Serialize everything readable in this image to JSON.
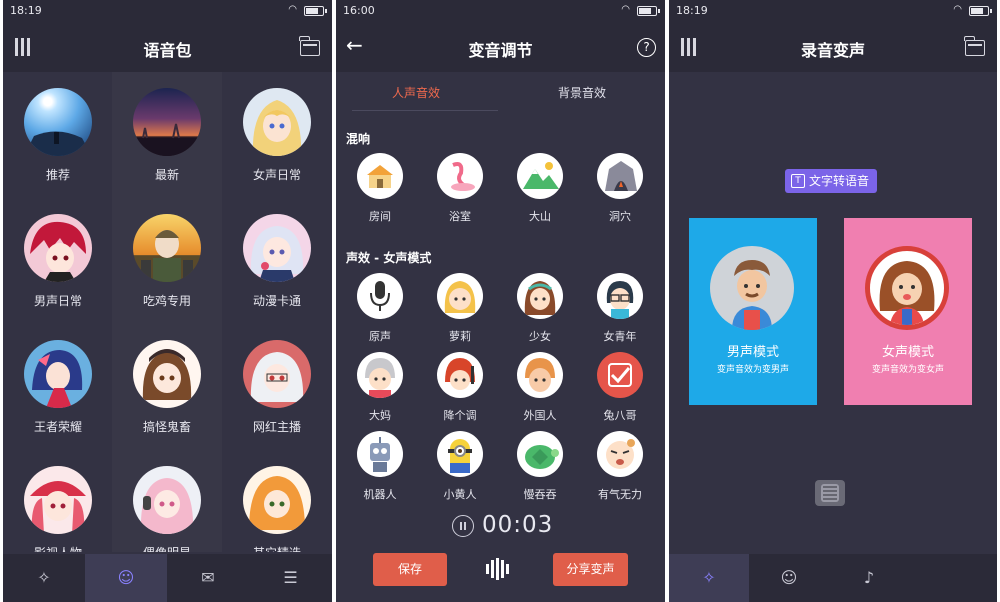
{
  "screen1": {
    "status_time": "18:19",
    "title": "语音包",
    "categories": [
      {
        "label": "推荐",
        "icon": "anime-sky-avatar"
      },
      {
        "label": "最新",
        "icon": "sunset-city-avatar"
      },
      {
        "label": "女声日常",
        "icon": "blonde-girl-avatar"
      },
      {
        "label": "男声日常",
        "icon": "red-hair-boy-avatar"
      },
      {
        "label": "吃鸡专用",
        "icon": "soldier-avatar"
      },
      {
        "label": "动漫卡通",
        "icon": "maid-girl-avatar"
      },
      {
        "label": "王者荣耀",
        "icon": "hero-avatar"
      },
      {
        "label": "搞怪鬼畜",
        "icon": "brown-hair-girl-avatar"
      },
      {
        "label": "网红主播",
        "icon": "white-hair-girl-avatar"
      },
      {
        "label": "影视人物",
        "icon": "red-hat-girl-avatar"
      },
      {
        "label": "偶像明星",
        "icon": "pink-hair-girl-avatar"
      },
      {
        "label": "其它精选",
        "icon": "orange-hair-girl-avatar"
      }
    ],
    "bottom_tabs": [
      "magic-wand-icon",
      "voice-pack-icon",
      "message-icon",
      "settings-sliders-icon"
    ]
  },
  "screen2": {
    "status_time": "16:00",
    "title": "变音调节",
    "tabs": [
      "人声音效",
      "背景音效"
    ],
    "section_reverb": "混响",
    "reverb": [
      "房间",
      "浴室",
      "大山",
      "洞穴"
    ],
    "section_voice": "声效 - 女声模式",
    "voices": [
      "原声",
      "萝莉",
      "少女",
      "女青年",
      "大妈",
      "降个调",
      "外国人",
      "兔八哥",
      "机器人",
      "小黄人",
      "慢吞吞",
      "有气无力"
    ],
    "timer": "00:03",
    "save_label": "保存",
    "share_label": "分享变声"
  },
  "screen3": {
    "status_time": "18:19",
    "title": "录音变声",
    "tts_label": "文字转语音",
    "male_title": "男声模式",
    "male_sub": "变声音效为变男声",
    "female_title": "女声模式",
    "female_sub": "变声音效为变女声"
  },
  "colors": {
    "bg": "#333243",
    "bar": "#2b2a38",
    "accent": "#f06a4e",
    "purple": "#7b64e8",
    "male": "#1ea9e8",
    "female": "#f07fb0"
  }
}
